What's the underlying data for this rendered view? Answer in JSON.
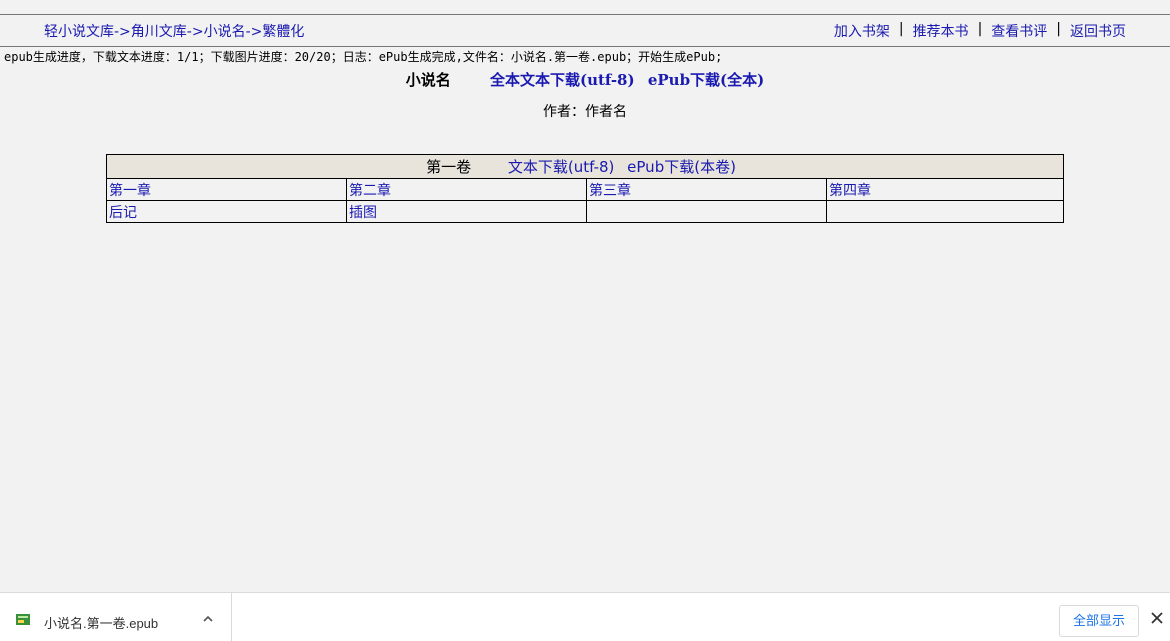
{
  "breadcrumb": {
    "items": [
      "轻小说文库",
      "角川文库",
      "小说名",
      "繁體化"
    ],
    "separator": "->"
  },
  "topnav": {
    "items": [
      "加入书架",
      "推荐本书",
      "查看书评",
      "返回书页"
    ],
    "separator": "|"
  },
  "progress_text": "epub生成进度，下载文本进度：1/1；下载图片进度：20/20；日志：ePub生成完成,文件名：小说名.第一卷.epub；开始生成ePub;",
  "novel": {
    "title": "小说名",
    "download_all_text": "全本文本下载(utf-8)",
    "download_all_epub": "ePub下载(全本)",
    "author_line": "作者：作者名"
  },
  "volume": {
    "title": "第一卷",
    "download_text": "文本下载(utf-8)",
    "download_epub": "ePub下载(本卷)",
    "chapters": [
      "第一章",
      "第二章",
      "第三章",
      "第四章",
      "后记",
      "插图",
      "",
      ""
    ]
  },
  "download_bar": {
    "file_name": "小说名.第一卷.epub",
    "file_icon": "epub-file-icon",
    "chevron_icon": "chevron-up-icon",
    "show_all_label": "全部显示",
    "close_icon": "close-icon"
  },
  "colors": {
    "link": "#1a1ab0",
    "background": "#f2f2f2",
    "volume_header_bg": "#e8e4dc",
    "show_all_text": "#1a73e8"
  }
}
